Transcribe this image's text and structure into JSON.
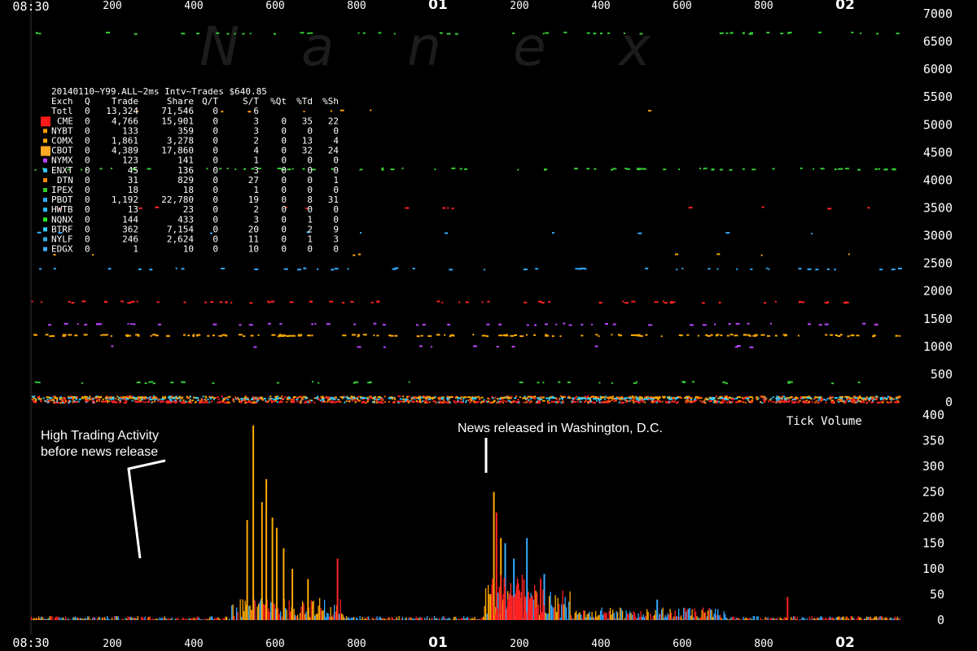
{
  "watermark": [
    "N",
    "a",
    "n",
    "e",
    "x"
  ],
  "time_axis": {
    "top_labels": [
      "08:30",
      "200",
      "400",
      "600",
      "800",
      "01",
      "200",
      "400",
      "600",
      "800",
      "02"
    ],
    "bottom_labels": [
      "08:30",
      "200",
      "400",
      "600",
      "800",
      "01",
      "200",
      "400",
      "600",
      "800",
      "02"
    ],
    "major_labels": [
      "01",
      "02"
    ]
  },
  "price_axis_labels": [
    "7000",
    "6500",
    "6000",
    "5500",
    "5000",
    "4500",
    "4000",
    "3500",
    "3000",
    "2500",
    "2000",
    "1500",
    "1000",
    "500",
    "0"
  ],
  "volume_axis_labels": [
    "400",
    "350",
    "300",
    "250",
    "200",
    "150",
    "100",
    "50",
    "0"
  ],
  "volume_panel_label": "Tick Volume",
  "annotations": {
    "left_line1": "High Trading Activity",
    "left_line2": "before news release",
    "right": "News released in Washington, D.C."
  },
  "table": {
    "title": "20140110~Y99.ALL~2ms Intv~Trades $640.85",
    "headers": [
      "Exch",
      "Q",
      "Trade",
      "Share",
      "Q/T",
      "S/T",
      "%Qt",
      "%Td",
      "%Sh"
    ],
    "rows": [
      {
        "exch": "Totl",
        "q": "0",
        "trade": "13,324",
        "share": "71,546",
        "qt": "0",
        "st": "6",
        "pqt": "",
        "ptd": "",
        "psh": "",
        "color": ""
      },
      {
        "exch": "CME",
        "q": "0",
        "trade": "4,766",
        "share": "15,901",
        "qt": "0",
        "st": "3",
        "pqt": "0",
        "ptd": "35",
        "psh": "22",
        "color": "#ff1a1a"
      },
      {
        "exch": "NYBT",
        "q": "0",
        "trade": "133",
        "share": "359",
        "qt": "0",
        "st": "3",
        "pqt": "0",
        "ptd": "0",
        "psh": "0",
        "color": "#ff9900"
      },
      {
        "exch": "COMX",
        "q": "0",
        "trade": "1,861",
        "share": "3,278",
        "qt": "0",
        "st": "2",
        "pqt": "0",
        "ptd": "13",
        "psh": "4",
        "color": "#ffaa00"
      },
      {
        "exch": "CBOT",
        "q": "0",
        "trade": "4,389",
        "share": "17,860",
        "qt": "0",
        "st": "4",
        "pqt": "0",
        "ptd": "32",
        "psh": "24",
        "color": "#ffaa22"
      },
      {
        "exch": "NYMX",
        "q": "0",
        "trade": "123",
        "share": "141",
        "qt": "0",
        "st": "1",
        "pqt": "0",
        "ptd": "0",
        "psh": "0",
        "color": "#bb44ff"
      },
      {
        "exch": "ENXT",
        "q": "0",
        "trade": "45",
        "share": "136",
        "qt": "0",
        "st": "3",
        "pqt": "0",
        "ptd": "0",
        "psh": "0",
        "color": "#33ccff"
      },
      {
        "exch": "DTN",
        "q": "0",
        "trade": "31",
        "share": "829",
        "qt": "0",
        "st": "27",
        "pqt": "0",
        "ptd": "0",
        "psh": "1",
        "color": "#ff8800"
      },
      {
        "exch": "IPEX",
        "q": "0",
        "trade": "18",
        "share": "18",
        "qt": "0",
        "st": "1",
        "pqt": "0",
        "ptd": "0",
        "psh": "0",
        "color": "#33cc33"
      },
      {
        "exch": "PBOT",
        "q": "0",
        "trade": "1,192",
        "share": "22,780",
        "qt": "0",
        "st": "19",
        "pqt": "0",
        "ptd": "8",
        "psh": "31",
        "color": "#33aaff"
      },
      {
        "exch": "HWTB",
        "q": "0",
        "trade": "13",
        "share": "23",
        "qt": "0",
        "st": "2",
        "pqt": "0",
        "ptd": "0",
        "psh": "0",
        "color": "#33bbff"
      },
      {
        "exch": "NQNX",
        "q": "0",
        "trade": "144",
        "share": "433",
        "qt": "0",
        "st": "3",
        "pqt": "0",
        "ptd": "1",
        "psh": "0",
        "color": "#22ee22"
      },
      {
        "exch": "BTRF",
        "q": "0",
        "trade": "362",
        "share": "7,154",
        "qt": "0",
        "st": "20",
        "pqt": "0",
        "ptd": "2",
        "psh": "9",
        "color": "#33ccff"
      },
      {
        "exch": "NYLF",
        "q": "0",
        "trade": "246",
        "share": "2,624",
        "qt": "0",
        "st": "11",
        "pqt": "0",
        "ptd": "1",
        "psh": "3",
        "color": "#33aadd"
      },
      {
        "exch": "EDGX",
        "q": "0",
        "trade": "1",
        "share": "10",
        "qt": "0",
        "st": "10",
        "pqt": "0",
        "ptd": "0",
        "psh": "0",
        "color": "#44aaff"
      }
    ]
  },
  "chart_data": [
    {
      "type": "scatter",
      "name": "price",
      "ylim": [
        0,
        7000
      ],
      "y_ticks": [
        0,
        500,
        1000,
        1500,
        2000,
        2500,
        3000,
        3500,
        4000,
        4500,
        5000,
        5500,
        6000,
        6500,
        7000
      ],
      "bands": [
        {
          "y": 6650,
          "color": "#33cc33",
          "density": 0.2
        },
        {
          "y": 5250,
          "color": "#ff9900",
          "density": 0.03
        },
        {
          "y": 4200,
          "color": "#33cc33",
          "density": 0.3
        },
        {
          "y": 3500,
          "color": "#ff2222",
          "density": 0.05
        },
        {
          "y": 3050,
          "color": "#33aaff",
          "density": 0.04
        },
        {
          "y": 2650,
          "color": "#ffaa00",
          "density": 0.03
        },
        {
          "y": 2400,
          "color": "#33aaff",
          "density": 0.18
        },
        {
          "y": 1800,
          "color": "#ff2222",
          "density": 0.25
        },
        {
          "y": 1400,
          "color": "#bb44ff",
          "density": 0.2
        },
        {
          "y": 1200,
          "color": "#ffaa00",
          "density": 0.55
        },
        {
          "y": 1000,
          "color": "#bb44ff",
          "density": 0.05
        },
        {
          "y": 350,
          "color": "#33cc33",
          "density": 0.15
        },
        {
          "y": 80,
          "color": "#ffaa00",
          "density": 0.95
        },
        {
          "y": 60,
          "color": "#33ccff",
          "density": 0.7
        },
        {
          "y": 0,
          "color": "#ff2222",
          "density": 0.95
        }
      ]
    },
    {
      "type": "bar",
      "name": "tick_volume",
      "ylim": [
        0,
        400
      ],
      "y_ticks": [
        0,
        50,
        100,
        150,
        200,
        250,
        300,
        350,
        400
      ],
      "peaks": [
        {
          "x_frac": 0.255,
          "value": 380,
          "color": "#ffaa00"
        },
        {
          "x_frac": 0.248,
          "value": 195,
          "color": "#ffaa00"
        },
        {
          "x_frac": 0.265,
          "value": 230,
          "color": "#ffaa00"
        },
        {
          "x_frac": 0.27,
          "value": 275,
          "color": "#ffaa00"
        },
        {
          "x_frac": 0.277,
          "value": 200,
          "color": "#ffaa00"
        },
        {
          "x_frac": 0.282,
          "value": 180,
          "color": "#ffaa00"
        },
        {
          "x_frac": 0.29,
          "value": 140,
          "color": "#ffaa00"
        },
        {
          "x_frac": 0.3,
          "value": 100,
          "color": "#ffaa00"
        },
        {
          "x_frac": 0.318,
          "value": 80,
          "color": "#ffaa00"
        },
        {
          "x_frac": 0.352,
          "value": 120,
          "color": "#ff2222"
        },
        {
          "x_frac": 0.532,
          "value": 250,
          "color": "#ffaa00"
        },
        {
          "x_frac": 0.535,
          "value": 210,
          "color": "#ff2222"
        },
        {
          "x_frac": 0.54,
          "value": 160,
          "color": "#ffaa00"
        },
        {
          "x_frac": 0.545,
          "value": 150,
          "color": "#33aaff"
        },
        {
          "x_frac": 0.555,
          "value": 120,
          "color": "#33aaff"
        },
        {
          "x_frac": 0.57,
          "value": 160,
          "color": "#33aaff"
        },
        {
          "x_frac": 0.59,
          "value": 90,
          "color": "#33aaff"
        },
        {
          "x_frac": 0.72,
          "value": 40,
          "color": "#33aaff"
        },
        {
          "x_frac": 0.87,
          "value": 45,
          "color": "#ff2222"
        }
      ]
    }
  ]
}
